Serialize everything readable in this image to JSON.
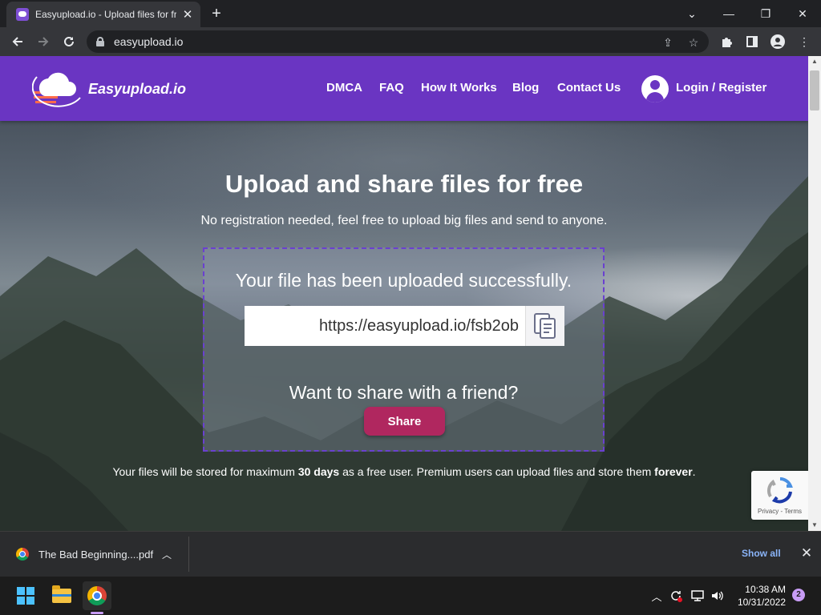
{
  "browser": {
    "tab_title": "Easyupload.io - Upload files for free",
    "tab_close": "✕",
    "new_tab": "+",
    "url": "easyupload.io",
    "window_controls": {
      "minimize": "—",
      "maximize": "❐",
      "close": "✕",
      "tabsearch": "⌄"
    }
  },
  "site": {
    "logo_text": "Easyupload.io",
    "nav": [
      "DMCA",
      "FAQ",
      "How It Works",
      "Blog",
      "Contact Us"
    ],
    "login_label": "Login / Register",
    "brand_color": "#6a35c2",
    "accent_color": "#b0275f"
  },
  "hero": {
    "title": "Upload and share files for free",
    "subtitle": "No registration needed, feel free to upload big files and send to anyone."
  },
  "upload_result": {
    "message": "Your file has been uploaded successfully.",
    "link": "https://easyupload.io/fsb2ob",
    "share_question": "Want to share with a friend?",
    "share_label": "Share"
  },
  "storage_note": {
    "prefix": "Your files will be stored for maximum ",
    "days": "30 days",
    "middle": " as a free user. Premium users can upload files and store them ",
    "forever": "forever",
    "suffix": "."
  },
  "recaptcha": {
    "links": "Privacy - Terms"
  },
  "downloads": {
    "file_name": "The Bad Beginning....pdf",
    "show_all": "Show all",
    "close": "✕"
  },
  "taskbar": {
    "time": "10:38 AM",
    "date": "10/31/2022",
    "notification_count": "2"
  }
}
